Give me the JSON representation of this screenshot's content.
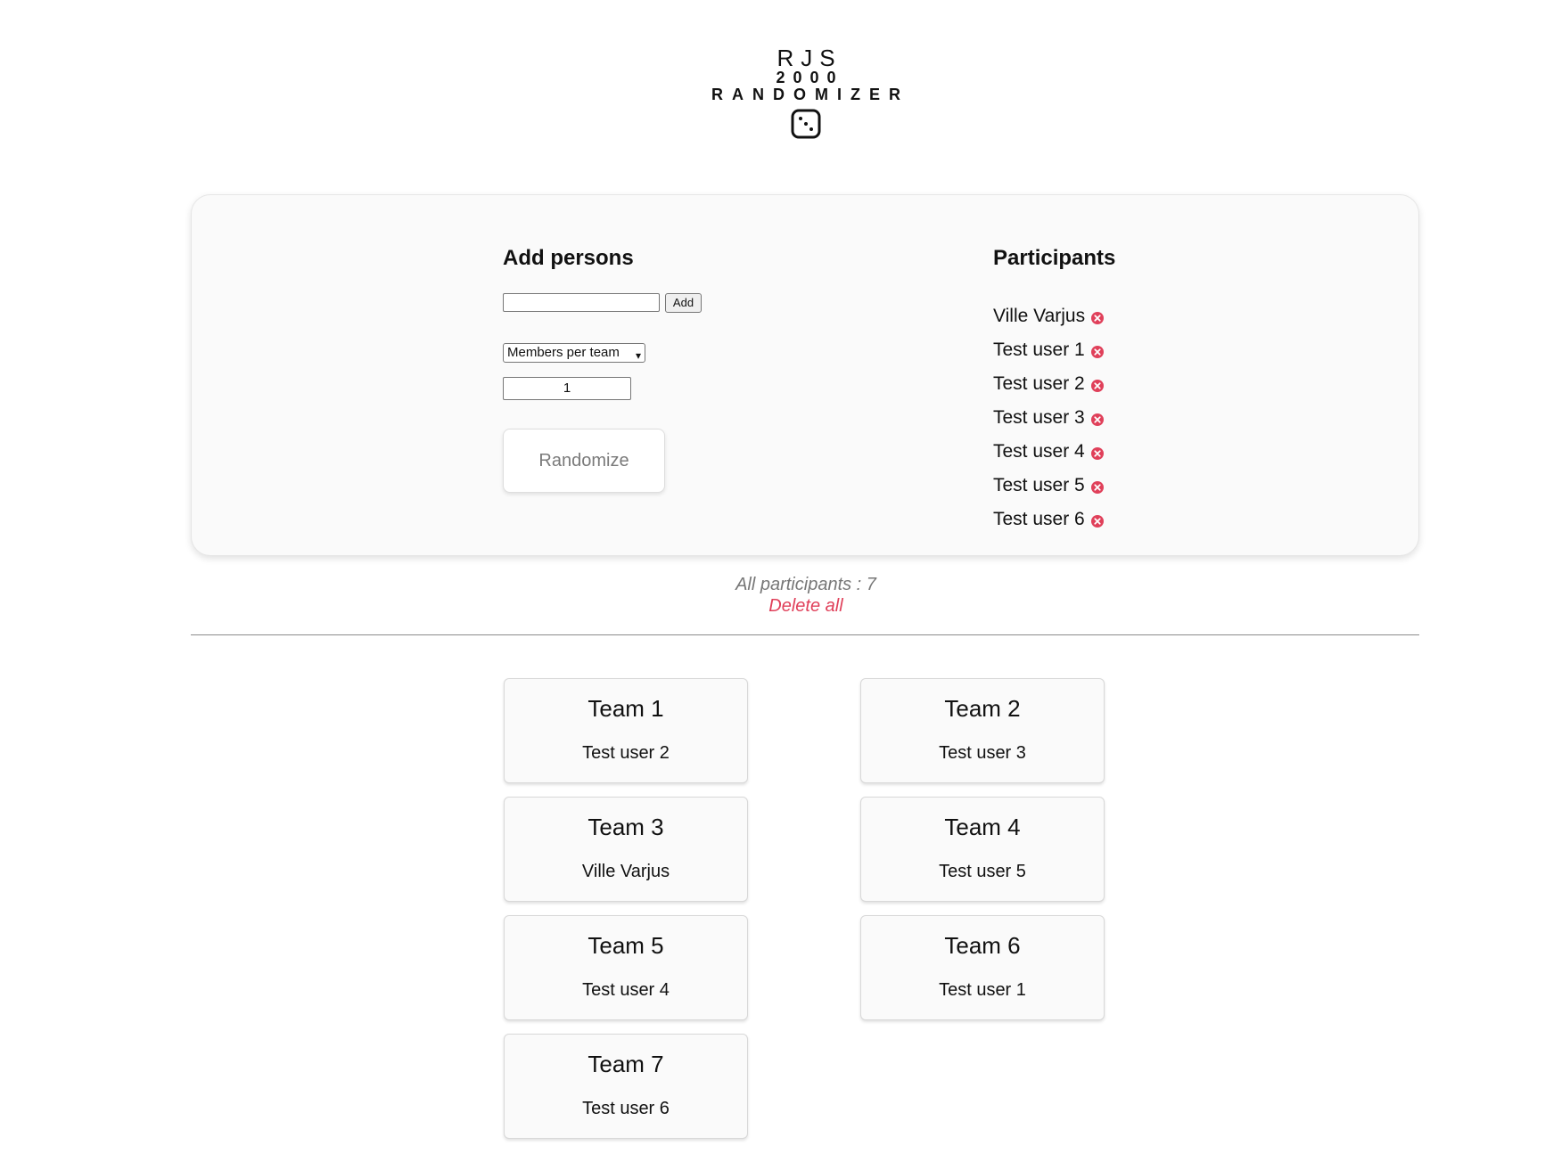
{
  "logo": {
    "line1": "RJS",
    "line2": "2000",
    "line3": "RANDOMIZER",
    "icon": "dice-icon"
  },
  "form": {
    "heading": "Add persons",
    "name_value": "",
    "add_label": "Add",
    "mode_selected": "Members per team",
    "count_value": "1",
    "randomize_label": "Randomize"
  },
  "participants": {
    "heading": "Participants",
    "items": [
      {
        "name": "Ville Varjus"
      },
      {
        "name": "Test user 1"
      },
      {
        "name": "Test user 2"
      },
      {
        "name": "Test user 3"
      },
      {
        "name": "Test user 4"
      },
      {
        "name": "Test user 5"
      },
      {
        "name": "Test user 6"
      }
    ]
  },
  "summary": {
    "count_text": "All participants : 7",
    "delete_label": "Delete all"
  },
  "teams": [
    {
      "name": "Team 1",
      "member": "Test user 2"
    },
    {
      "name": "Team 2",
      "member": "Test user 3"
    },
    {
      "name": "Team 3",
      "member": "Ville Varjus"
    },
    {
      "name": "Team 4",
      "member": "Test user 5"
    },
    {
      "name": "Team 5",
      "member": "Test user 4"
    },
    {
      "name": "Team 6",
      "member": "Test user 1"
    },
    {
      "name": "Team 7",
      "member": "Test user 6"
    }
  ],
  "colors": {
    "remove": "#e0405a",
    "delete": "#e0405a"
  }
}
